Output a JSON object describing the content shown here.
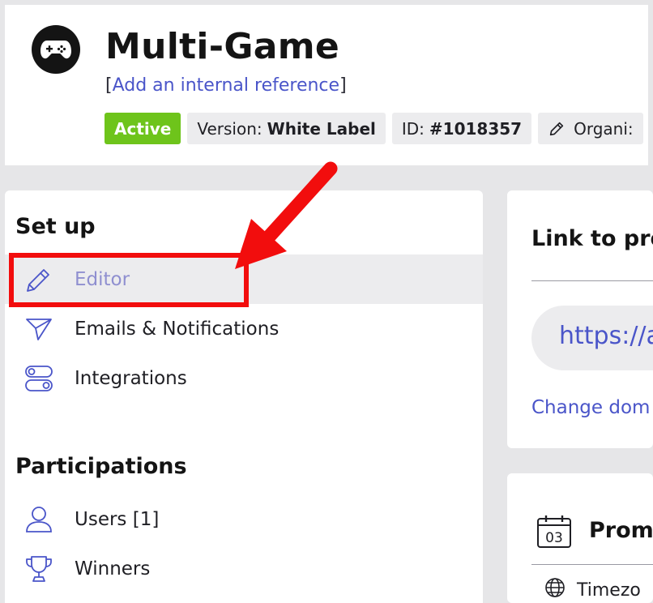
{
  "header": {
    "logo_icon": "gamepad-icon",
    "title": "Multi-Game",
    "reference_open": "[",
    "reference_link": "Add an internal reference",
    "reference_close": "]",
    "badges": {
      "status": "Active",
      "version_label": "Version:",
      "version_value": "White Label",
      "id_label": "ID:",
      "id_value": "#1018357",
      "organizer_label": "Organi:"
    }
  },
  "sidebar": {
    "setup_title": "Set up",
    "setup_items": [
      {
        "label": "Editor",
        "icon": "pencil-icon",
        "selected": true
      },
      {
        "label": "Emails & Notifications",
        "icon": "paper-plane-icon"
      },
      {
        "label": "Integrations",
        "icon": "toggles-icon"
      }
    ],
    "participations_title": "Participations",
    "participations_items": [
      {
        "label": "Users [1]",
        "icon": "user-icon"
      },
      {
        "label": "Winners",
        "icon": "trophy-icon"
      }
    ]
  },
  "link_card": {
    "title": "Link to pro",
    "url": "https://a",
    "change_domain": "Change dom"
  },
  "promo_card": {
    "calendar_day": "03",
    "title": "Prom",
    "timezone": "Timezo"
  },
  "colors": {
    "accent": "#4a55c9",
    "active_badge": "#6ec41b",
    "annotation": "#f20d0d",
    "selected_text": "#8f8fd0"
  }
}
